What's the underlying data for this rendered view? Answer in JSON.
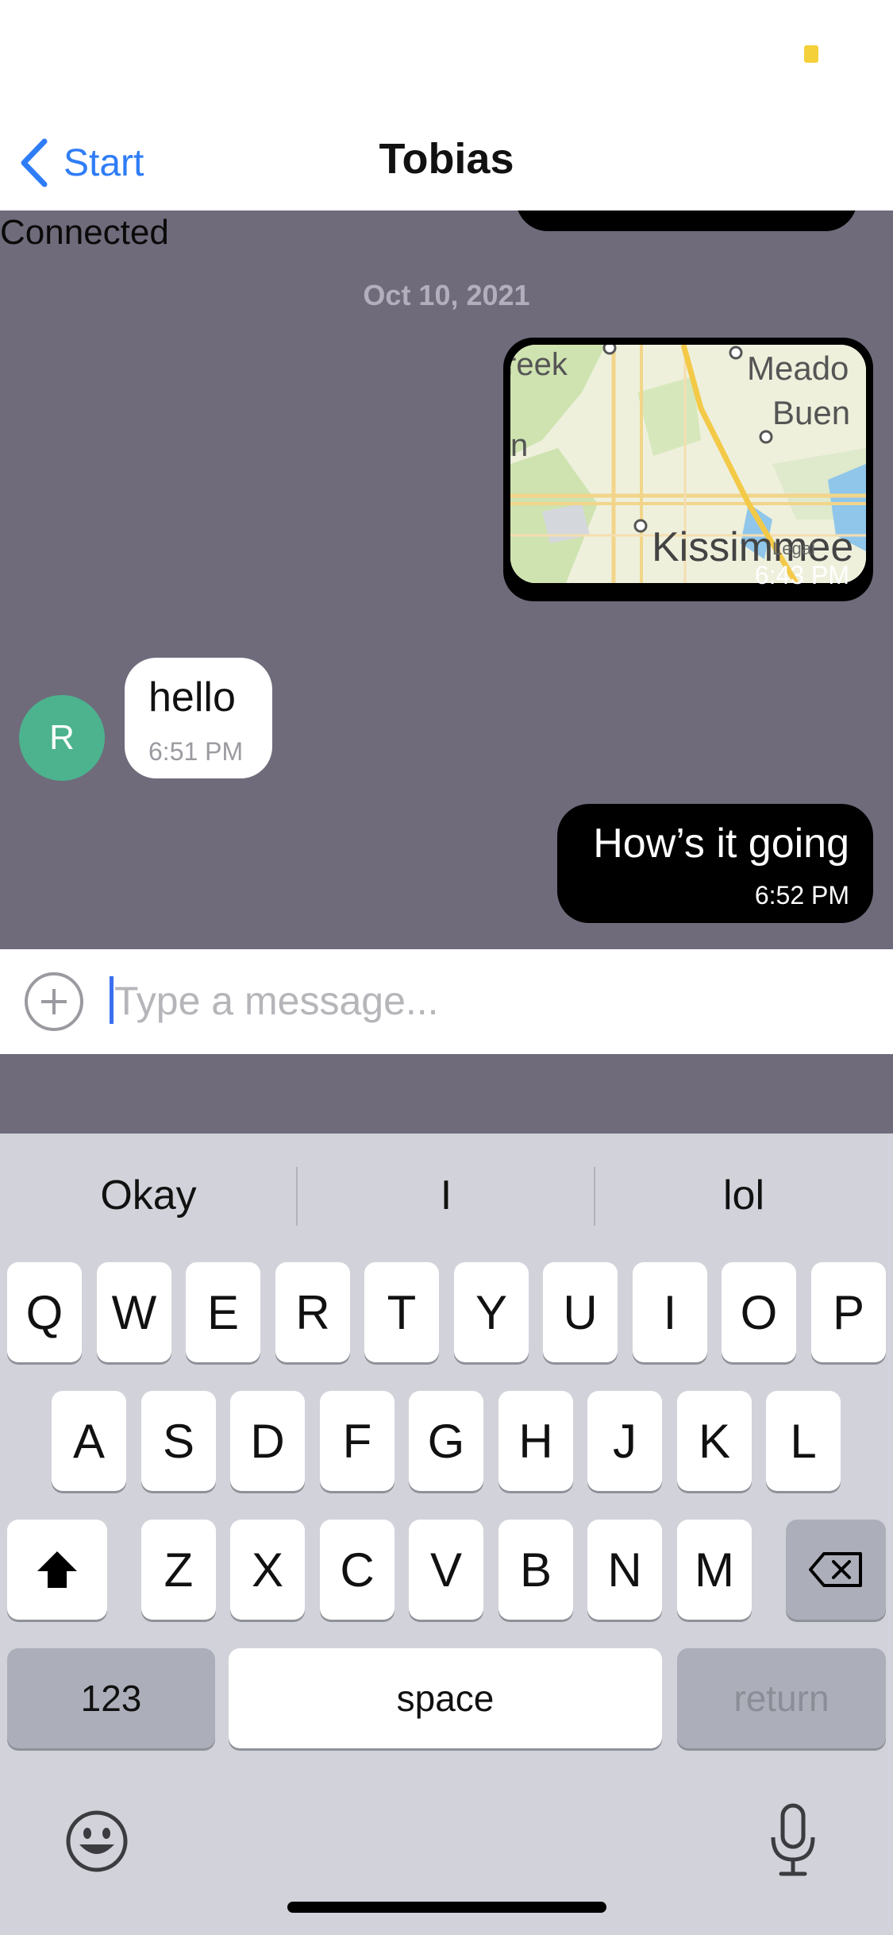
{
  "nav": {
    "back_label": "Start",
    "title": "Tobias"
  },
  "chat": {
    "connection_status": "Connected",
    "date_header": "Oct 10, 2021",
    "messages": [
      {
        "sender": "me",
        "type": "map",
        "map_labels": [
          "reek",
          "Meado",
          "Buen",
          "n",
          "Kissimmee",
          "Legal"
        ],
        "time": "6:43 PM"
      },
      {
        "sender": "other",
        "type": "text",
        "avatar_initial": "R",
        "avatar_color": "#4cb38e",
        "text": "hello",
        "time": "6:51 PM"
      },
      {
        "sender": "me",
        "type": "text",
        "text": "How’s it going",
        "time": "6:52 PM"
      }
    ]
  },
  "composer": {
    "placeholder": "Type a message...",
    "attach_icon": "plus-circle-icon"
  },
  "keyboard": {
    "suggestions": [
      "Okay",
      "I",
      "lol"
    ],
    "row1": [
      "Q",
      "W",
      "E",
      "R",
      "T",
      "Y",
      "U",
      "I",
      "O",
      "P"
    ],
    "row2": [
      "A",
      "S",
      "D",
      "F",
      "G",
      "H",
      "J",
      "K",
      "L"
    ],
    "row3": [
      "Z",
      "X",
      "C",
      "V",
      "B",
      "N",
      "M"
    ],
    "numbers_label": "123",
    "space_label": "space",
    "return_label": "return",
    "shift_icon": "shift-icon",
    "delete_icon": "delete-backspace-icon",
    "emoji_icon": "emoji-icon",
    "mic_icon": "microphone-icon"
  },
  "colors": {
    "accent": "#2f7df6",
    "chat_background": "#6f6b7b",
    "outgoing_bubble": "#000000",
    "incoming_bubble": "#ffffff",
    "keyboard_background": "#d2d3da"
  }
}
